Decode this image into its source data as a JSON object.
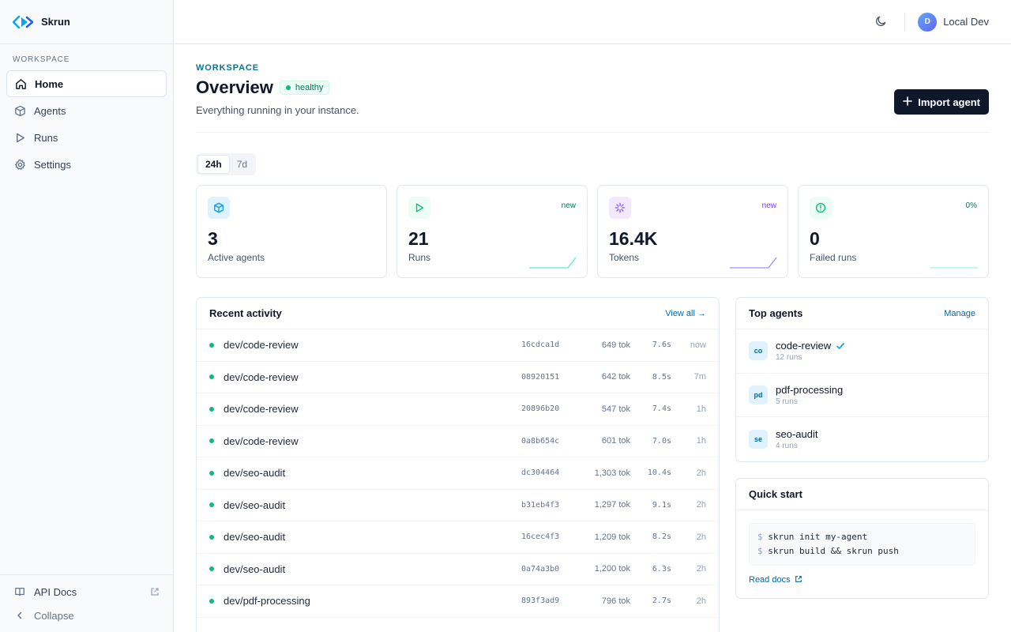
{
  "brand": {
    "name": "Skrun"
  },
  "sidebar": {
    "section_label": "WORKSPACE",
    "items": [
      {
        "label": "Home",
        "icon": "home-icon",
        "active": true
      },
      {
        "label": "Agents",
        "icon": "box-icon",
        "active": false
      },
      {
        "label": "Runs",
        "icon": "play-icon",
        "active": false
      },
      {
        "label": "Settings",
        "icon": "gear-icon",
        "active": false
      }
    ],
    "bottom": {
      "api_docs": "API Docs",
      "collapse": "Collapse"
    }
  },
  "topbar": {
    "user_initial": "D",
    "user_name": "Local Dev"
  },
  "header": {
    "eyebrow": "WORKSPACE",
    "title": "Overview",
    "status": "healthy",
    "subtitle": "Everything running in your instance.",
    "import_label": "Import agent"
  },
  "range": {
    "options": [
      "24h",
      "7d"
    ],
    "selected": "24h"
  },
  "stats": [
    {
      "value": "3",
      "label": "Active agents",
      "tag": "",
      "icon": "box-icon",
      "color": "#0ea5e9",
      "bg": "#e0f2fe"
    },
    {
      "value": "21",
      "label": "Runs",
      "tag": "new",
      "icon": "play-icon",
      "color": "#10b981",
      "bg": "#ecfdf5",
      "tag_color": "#047857"
    },
    {
      "value": "16.4K",
      "label": "Tokens",
      "tag": "new",
      "icon": "sparkle-icon",
      "color": "#8b5cf6",
      "bg": "#f3e8ff",
      "tag_color": "#7c3aed"
    },
    {
      "value": "0",
      "label": "Failed runs",
      "tag": "0%",
      "icon": "alert-icon",
      "color": "#10b981",
      "bg": "#ecfdf5",
      "tag_color": "#047857"
    }
  ],
  "activity": {
    "title": "Recent activity",
    "view_all": "View all →",
    "rows": [
      {
        "name": "dev/code-review",
        "id": "16cdca1d",
        "tokens": "649 tok",
        "duration": "7.6s",
        "when": "now"
      },
      {
        "name": "dev/code-review",
        "id": "08920151",
        "tokens": "642 tok",
        "duration": "8.5s",
        "when": "7m"
      },
      {
        "name": "dev/code-review",
        "id": "20896b20",
        "tokens": "547 tok",
        "duration": "7.4s",
        "when": "1h"
      },
      {
        "name": "dev/code-review",
        "id": "0a8b654c",
        "tokens": "601 tok",
        "duration": "7.0s",
        "when": "1h"
      },
      {
        "name": "dev/seo-audit",
        "id": "dc304464",
        "tokens": "1,303 tok",
        "duration": "10.4s",
        "when": "2h"
      },
      {
        "name": "dev/seo-audit",
        "id": "b31eb4f3",
        "tokens": "1,297 tok",
        "duration": "9.1s",
        "when": "2h"
      },
      {
        "name": "dev/seo-audit",
        "id": "16cec4f3",
        "tokens": "1,209 tok",
        "duration": "8.2s",
        "when": "2h"
      },
      {
        "name": "dev/seo-audit",
        "id": "0a74a3b0",
        "tokens": "1,200 tok",
        "duration": "6.3s",
        "when": "2h"
      },
      {
        "name": "dev/pdf-processing",
        "id": "893f3ad9",
        "tokens": "796 tok",
        "duration": "2.7s",
        "when": "2h"
      }
    ]
  },
  "top_agents": {
    "title": "Top agents",
    "manage": "Manage",
    "items": [
      {
        "abbr": "co",
        "name": "code-review",
        "runs": "12 runs",
        "verified": true
      },
      {
        "abbr": "pd",
        "name": "pdf-processing",
        "runs": "5 runs",
        "verified": false
      },
      {
        "abbr": "se",
        "name": "seo-audit",
        "runs": "4 runs",
        "verified": false
      }
    ]
  },
  "quick_start": {
    "title": "Quick start",
    "lines": [
      "skrun init my-agent",
      "skrun build && skrun push"
    ],
    "prompt": "$",
    "docs_label": "Read docs"
  }
}
